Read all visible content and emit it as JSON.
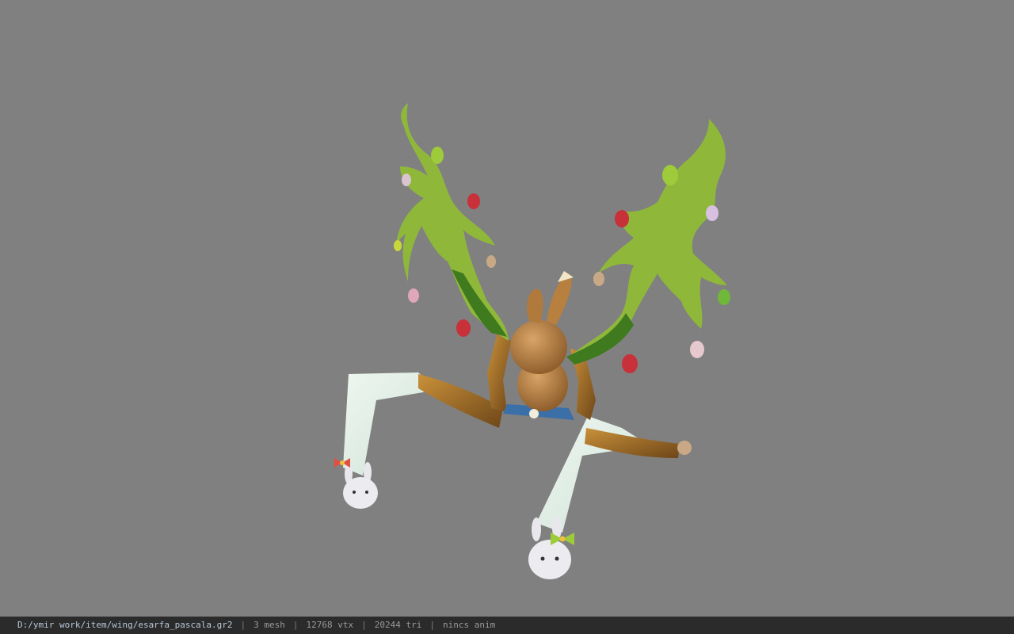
{
  "viewer": {
    "background_color": "#808080",
    "model_subject": "wing-model"
  },
  "status_bar": {
    "file_path": "D:/ymir work/item/wing/esarfa_pascala.gr2",
    "separator": "|",
    "mesh_count": "3 mesh",
    "vertex_count": "12768 vtx",
    "triangle_count": "20244 tri",
    "animation_status": "nincs anim"
  },
  "colors": {
    "status_bg": "#2b2b2b",
    "status_text": "#9a9a9a",
    "path_text": "#b8c8d8",
    "leaf_green": "#8fb83a",
    "leaf_dark": "#3f7a1e",
    "bunny_brown": "#b07a3c",
    "egg_red": "#c8303a",
    "ribbon": "#e6efe8"
  }
}
